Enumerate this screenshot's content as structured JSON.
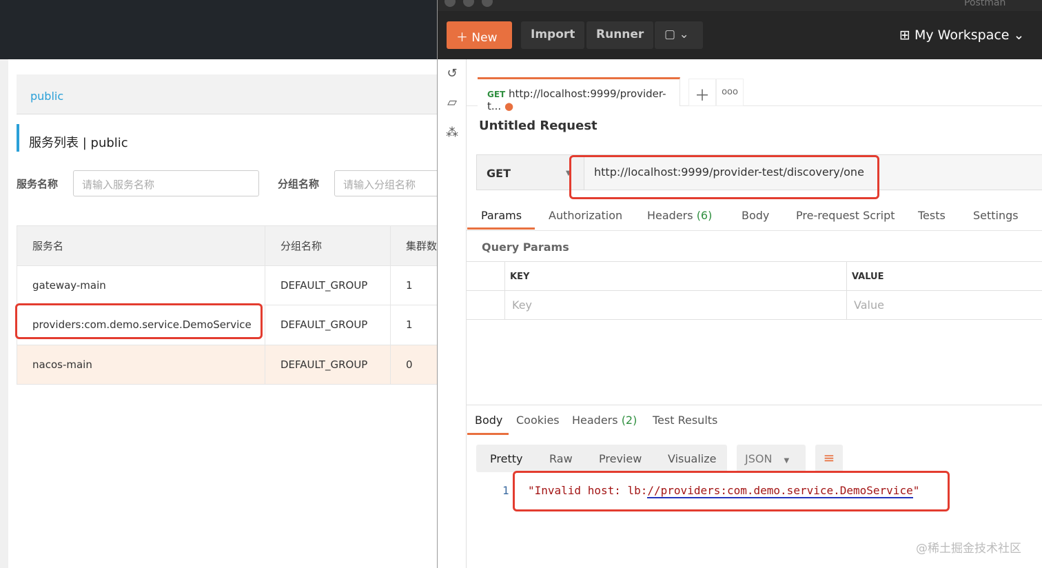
{
  "nacos": {
    "namespace": "public",
    "title": "服务列表",
    "title_sep": "|",
    "title_ns": "public",
    "service_label": "服务名称",
    "service_placeholder": "请输入服务名称",
    "group_label": "分组名称",
    "group_placeholder": "请输入分组名称",
    "columns": [
      "服务名",
      "分组名称",
      "集群数"
    ],
    "rows": [
      [
        "gateway-main",
        "DEFAULT_GROUP",
        "1"
      ],
      [
        "providers:com.demo.service.DemoService",
        "DEFAULT_GROUP",
        "1"
      ],
      [
        "nacos-main",
        "DEFAULT_GROUP",
        "0"
      ]
    ]
  },
  "postman": {
    "app_title": "Postman",
    "new": "New",
    "import": "Import",
    "runner": "Runner",
    "workspace": "My Workspace",
    "tab": {
      "method": "GET",
      "url": "http://localhost:9999/provider-t..."
    },
    "request_name": "Untitled Request",
    "method": "GET",
    "url": "http://localhost:9999/provider-test/discovery/one",
    "req_tabs": [
      "Params",
      "Authorization",
      "Headers",
      "Body",
      "Pre-request Script",
      "Tests",
      "Settings"
    ],
    "req_headers_count": "(6)",
    "query_params": "Query Params",
    "key_col": "KEY",
    "value_col": "VALUE",
    "key_ph": "Key",
    "value_ph": "Value",
    "resp_tabs": [
      "Body",
      "Cookies",
      "Headers",
      "Test Results"
    ],
    "resp_headers_count": "(2)",
    "view_modes": [
      "Pretty",
      "Raw",
      "Preview",
      "Visualize"
    ],
    "format": "JSON",
    "line_no": "1",
    "response_prefix": "\"Invalid host: lb:",
    "response_link": "//providers:com.demo.service.DemoService",
    "response_suffix": "\""
  },
  "watermark": "@稀土掘金技术社区",
  "colors": {
    "accent": "#e8703f",
    "highlight": "#e33c2f",
    "nacos_blue": "#2aa0d8"
  }
}
